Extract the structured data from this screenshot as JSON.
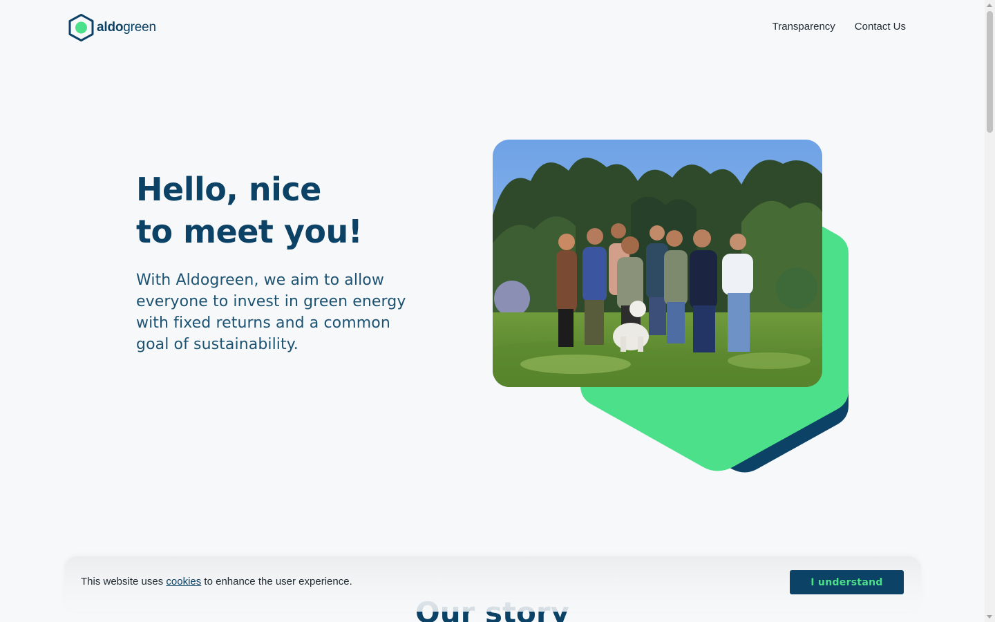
{
  "header": {
    "logo": {
      "bold": "aldo",
      "regular": "green"
    },
    "nav": [
      {
        "label": "Transparency"
      },
      {
        "label": "Contact Us"
      }
    ]
  },
  "hero": {
    "title_line1": "Hello, nice",
    "title_line2": "to meet you!",
    "subtitle": "With Aldogreen, we aim to allow everyone to invest in green energy with fixed returns and a common goal of sustainability."
  },
  "section": {
    "title": "Our story"
  },
  "cookie_banner": {
    "text_before": "This website uses",
    "link": "cookies",
    "text_after": "to enhance the user experience.",
    "button": "I understand"
  },
  "colors": {
    "brand_navy": "#0c4266",
    "brand_green": "#4ce08a",
    "background": "#f7f8f9"
  },
  "icons": {
    "logo": "hexagon-logo-icon"
  }
}
